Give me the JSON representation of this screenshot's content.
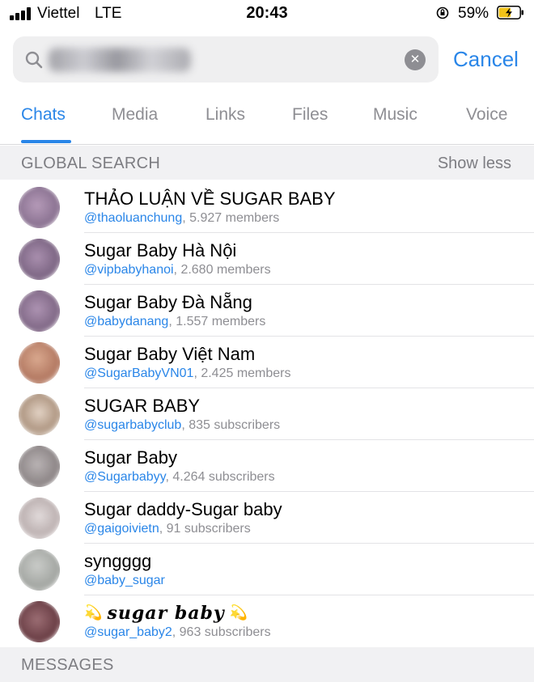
{
  "status_bar": {
    "carrier": "Viettel",
    "network": "LTE",
    "time": "20:43",
    "battery_percent": "59%",
    "battery_level": 0.59,
    "charging": true
  },
  "search": {
    "query_obscured": true,
    "clear_icon": "clear-circle-x-icon",
    "cancel_label": "Cancel"
  },
  "tabs": [
    {
      "label": "Chats",
      "active": true
    },
    {
      "label": "Media",
      "active": false
    },
    {
      "label": "Links",
      "active": false
    },
    {
      "label": "Files",
      "active": false
    },
    {
      "label": "Music",
      "active": false
    },
    {
      "label": "Voice",
      "active": false
    }
  ],
  "global_search": {
    "title": "GLOBAL SEARCH",
    "action_label": "Show less",
    "results": [
      {
        "name": "THẢO LUẬN VỀ SUGAR BABY",
        "handle": "@thaoluanchung",
        "meta": ", 5.927 members"
      },
      {
        "name": "Sugar Baby Hà Nội",
        "handle": "@vipbabyhanoi",
        "meta": ", 2.680 members"
      },
      {
        "name": "Sugar Baby Đà Nẵng",
        "handle": "@babydanang",
        "meta": ", 1.557 members"
      },
      {
        "name": "Sugar Baby Việt Nam",
        "handle": "@SugarBabyVN01",
        "meta": ", 2.425 members"
      },
      {
        "name": "SUGAR BABY",
        "handle": "@sugarbabyclub",
        "meta": ", 835 subscribers"
      },
      {
        "name": "Sugar Baby",
        "handle": "@Sugarbabyy",
        "meta": ", 4.264 subscribers"
      },
      {
        "name": "Sugar daddy-Sugar baby",
        "handle": "@gaigoivietn",
        "meta": ", 91 subscribers"
      },
      {
        "name": "syngggg",
        "handle": "@baby_sugar",
        "meta": ""
      },
      {
        "name": "sugar baby",
        "handle": "@sugar_baby2",
        "meta": ", 963 subscribers"
      }
    ]
  },
  "messages": {
    "title": "MESSAGES"
  },
  "colors": {
    "accent": "#2a86e8",
    "secondary_text": "#8e8e93",
    "section_bg": "#f1f1f3"
  }
}
